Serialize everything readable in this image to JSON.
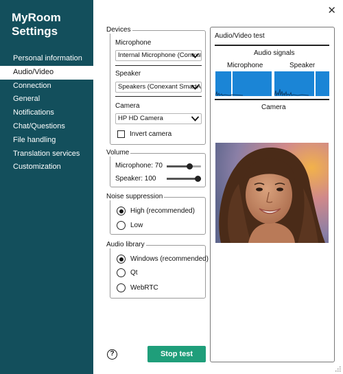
{
  "app": {
    "title": "MyRoom Settings"
  },
  "sidebar": {
    "items": [
      {
        "label": "Personal information",
        "active": false
      },
      {
        "label": "Audio/Video",
        "active": true
      },
      {
        "label": "Connection",
        "active": false
      },
      {
        "label": "General",
        "active": false
      },
      {
        "label": "Notifications",
        "active": false
      },
      {
        "label": "Chat/Questions",
        "active": false
      },
      {
        "label": "File handling",
        "active": false
      },
      {
        "label": "Translation services",
        "active": false
      },
      {
        "label": "Customization",
        "active": false
      }
    ]
  },
  "devices": {
    "legend": "Devices",
    "microphone_label": "Microphone",
    "microphone_value": "Internal Microphone (Conexant",
    "speaker_label": "Speaker",
    "speaker_value": "Speakers (Conexant SmartAudio",
    "camera_label": "Camera",
    "camera_value": "HP HD Camera",
    "invert_label": "Invert camera",
    "invert_checked": false
  },
  "volume": {
    "legend": "Volume",
    "microphone_label": "Microphone: 70",
    "microphone_level": 0.7,
    "speaker_label": "Speaker: 100",
    "speaker_level": 1.0
  },
  "noise": {
    "legend": "Noise suppression",
    "options": [
      {
        "label": "High (recommended)",
        "selected": true
      },
      {
        "label": "Low",
        "selected": false
      }
    ]
  },
  "library": {
    "legend": "Audio library",
    "options": [
      {
        "label": "Windows (recommended)",
        "selected": true
      },
      {
        "label": "Qt",
        "selected": false
      },
      {
        "label": "WebRTC",
        "selected": false
      }
    ]
  },
  "test": {
    "title": "Audio/Video test",
    "signals_label": "Audio signals",
    "microphone_label": "Microphone",
    "speaker_label": "Speaker",
    "camera_label": "Camera"
  },
  "actions": {
    "stop_label": "Stop test",
    "help_glyph": "?",
    "close_glyph": "✕"
  },
  "colors": {
    "sidebar": "#134f5c",
    "accent": "#1f9e7a",
    "meter": "#1b85d6"
  },
  "icons": {
    "close": "close-icon",
    "help": "help-icon",
    "dropdown": "chevron-down-icon",
    "resize": "resize-grip-icon"
  }
}
